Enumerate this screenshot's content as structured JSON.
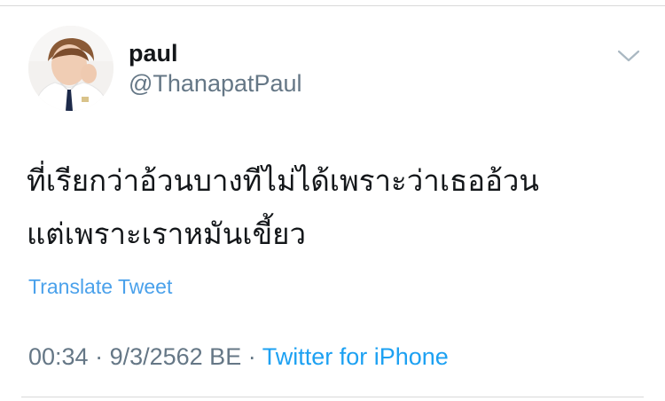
{
  "tweet": {
    "author": {
      "display_name": "paul",
      "handle": "@ThanapatPaul",
      "avatar_icon": "profile-photo"
    },
    "menu_icon": "chevron-down-icon",
    "text_lines": [
      "ที่เรียกว่าอ้วนบางทีไม่ได้เพราะว่าเธออ้วน",
      "แต่เพราะเราหมันเขี้ยว"
    ],
    "translate_label": "Translate Tweet",
    "time": "00:34",
    "separator_1": " · ",
    "date": "9/3/2562 BE",
    "separator_2": " · ",
    "source": "Twitter for iPhone"
  },
  "colors": {
    "text_primary": "#14171a",
    "text_secondary": "#657786",
    "link": "#1da1f2",
    "divider": "#d9d9d9"
  }
}
